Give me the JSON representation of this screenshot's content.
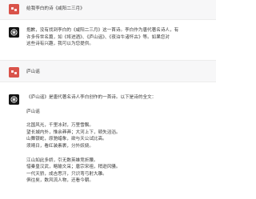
{
  "conversation": {
    "q1": "给我李白的诗《咸阳二三月》",
    "a1": [
      "抱歉，没有找到李白的《咸阳二三月》这一首诗。李白作为唐代著名诗人，有",
      "许多传世名篇，如《将进酒》、《庐山谣》、《夜泊牛渚怀古》等。如果您对",
      "这些诗有兴趣，我可以为您提供。"
    ],
    "q2": "庐山谣",
    "a2_intro": "《庐山谣》是唐代著名诗人李白创作的一首诗。以下是诗的全文：",
    "a2_title": "庐山谣",
    "poem_stanza1": [
      "北国风光，千里冰封，万里雪飘。",
      "望长城内外，惟余莽莽；大河上下，顿失滔滔。",
      "山舞银蛇，原驰蜡象，欲与天公试比高。",
      "须晴日，看红装素裹，分外妖娆。"
    ],
    "poem_stanza2": [
      "江山如此多娇，引无数英雄竞折腰。",
      "惜秦皇汉武，略输文采；唐宗宋祖，稍逊风骚。",
      "一代天骄，成吉思汗，只识弯弓射大雕。",
      "俱往矣，数风流人物，还看今朝。"
    ]
  },
  "colors": {
    "user_bg": "#f7f7f8",
    "user_avatar": "#d9534a",
    "bot_avatar": "#151515"
  },
  "icons": {
    "user_avatar": "user-avatar-icon",
    "bot_avatar": "openai-logo-icon"
  }
}
